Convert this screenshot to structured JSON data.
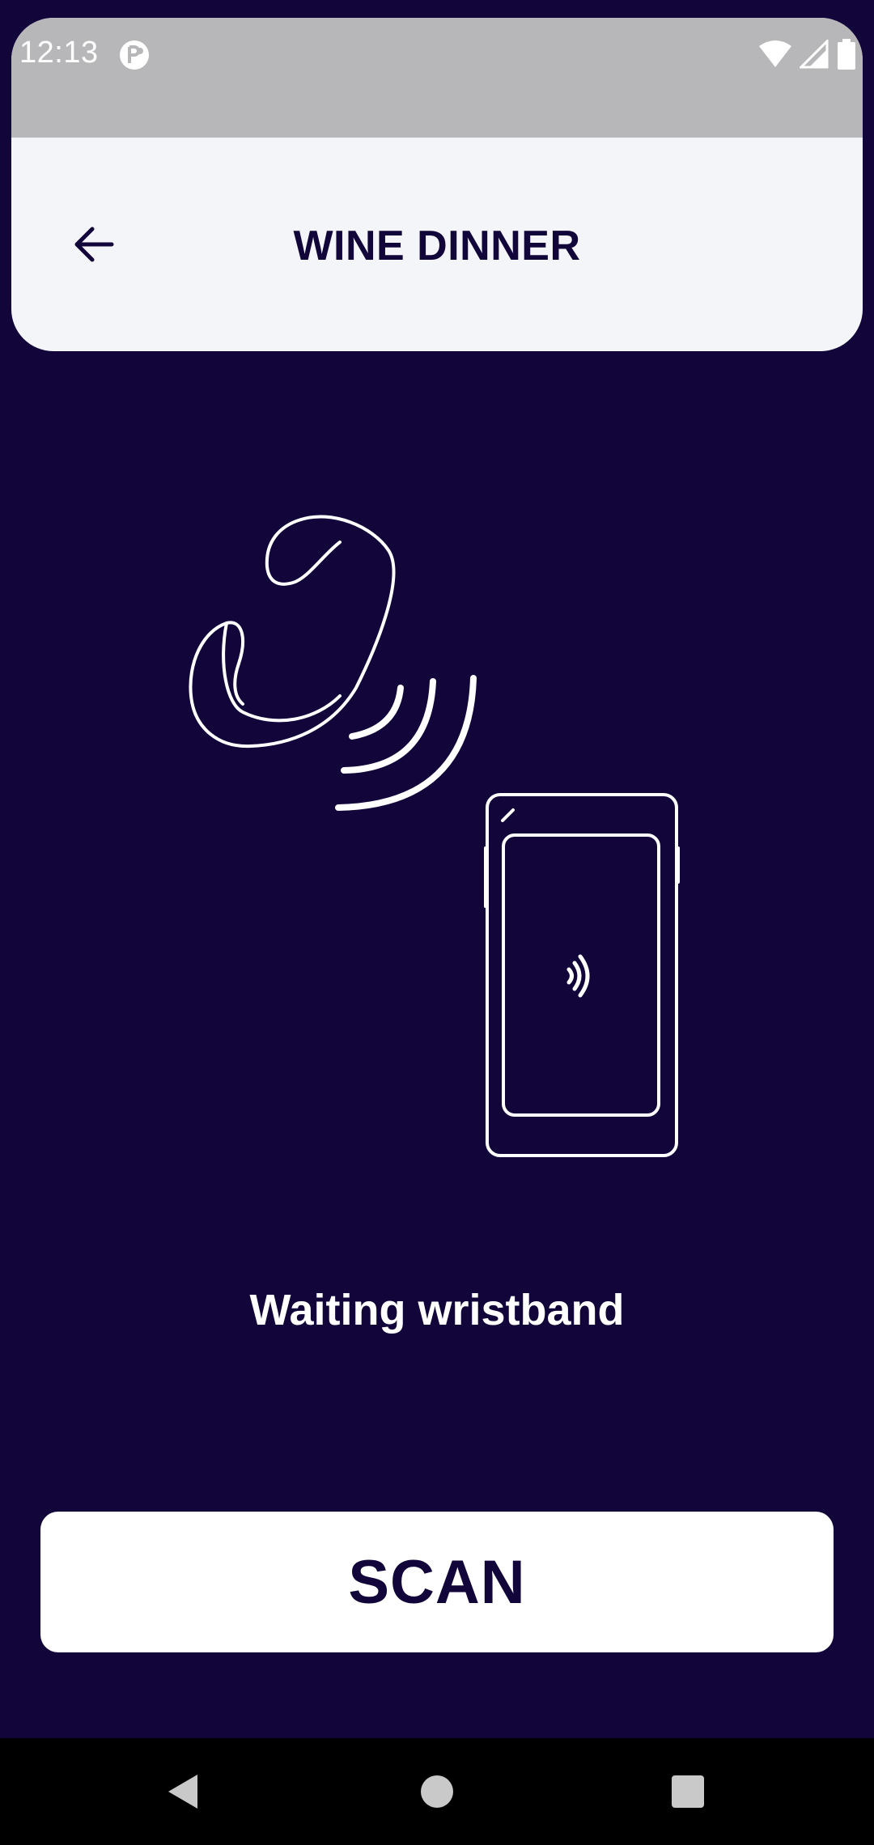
{
  "status_bar": {
    "time": "12:13",
    "icons": [
      "app-notification-icon",
      "wifi-icon",
      "signal-icon",
      "battery-icon"
    ]
  },
  "app_bar": {
    "title": "WINE DINNER",
    "back_icon": "arrow-left-icon"
  },
  "illustration": {
    "description_icons": [
      "wristband-icon",
      "nfc-waves-icon",
      "phone-icon"
    ]
  },
  "main": {
    "status_text": "Waiting wristband",
    "scan_label": "SCAN"
  },
  "nav_bar": {
    "buttons": [
      "back-triangle-icon",
      "home-circle-icon",
      "recents-square-icon"
    ]
  },
  "colors": {
    "background": "#12053A",
    "card": "#F4F5F8",
    "status_bar": "#B7B7B9",
    "accent_text": "#12053A",
    "white": "#FFFFFF"
  }
}
